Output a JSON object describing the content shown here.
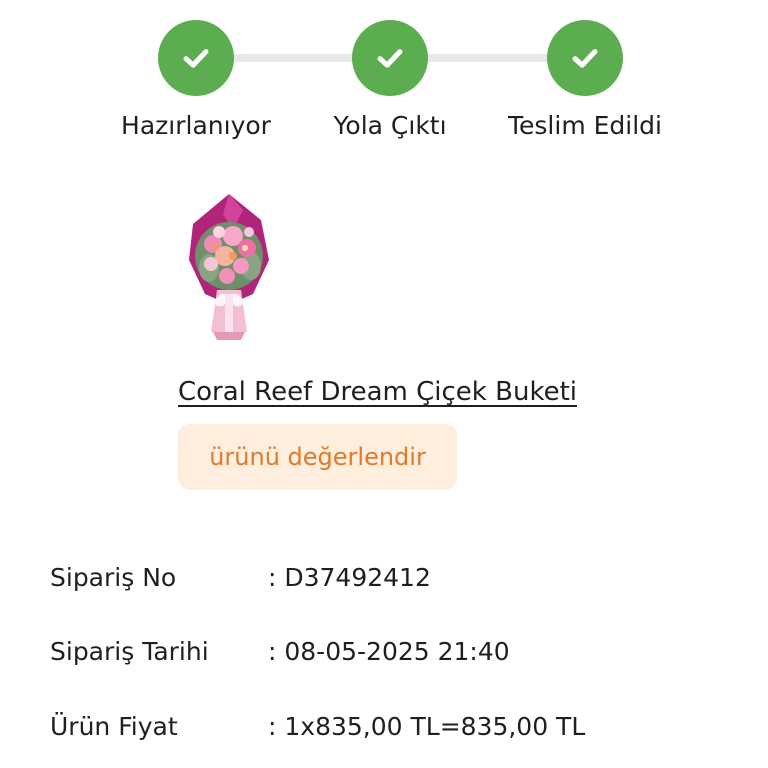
{
  "tracker": {
    "accent_color": "#5cad4f",
    "steps": [
      {
        "label": "Hazırlanıyor",
        "icon": "check-icon",
        "completed": true
      },
      {
        "label": "Yola Çıktı",
        "icon": "check-icon",
        "completed": true
      },
      {
        "label": "Teslim Edildi",
        "icon": "check-icon",
        "completed": true
      }
    ]
  },
  "product": {
    "name": "Coral Reef Dream Çiçek Buketi",
    "image_icon": "flower-bouquet-image",
    "review_button_label": "ürünü değerlendir",
    "review_button_text_color": "#e07a2c",
    "review_button_bg_color": "#fdeede"
  },
  "order": {
    "rows": [
      {
        "label": "Sipariş No",
        "value": ": D37492412"
      },
      {
        "label": "Sipariş Tarihi",
        "value": ": 08-05-2025 21:40"
      },
      {
        "label": "Ürün Fiyat",
        "value": ": 1x835,00 TL=835,00 TL"
      }
    ]
  }
}
